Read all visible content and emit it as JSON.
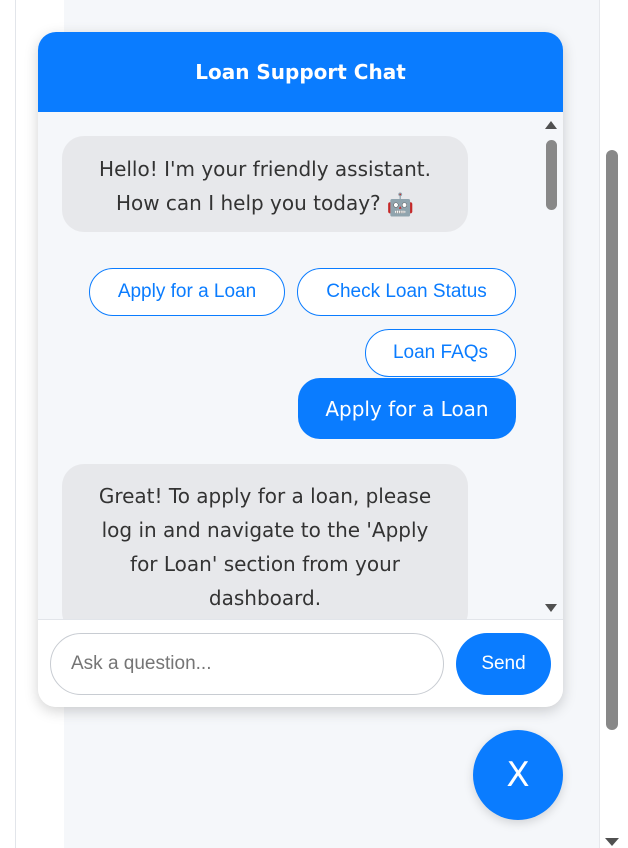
{
  "colors": {
    "accent": "#0a7cff",
    "bot_bubble": "#e7e8eb",
    "panel_bg": "#f5f7fa",
    "text": "#333333"
  },
  "chat": {
    "title": "Loan Support Chat",
    "messages": [
      {
        "from": "bot",
        "lines": [
          "Hello! I'm your friendly assistant.",
          "How can I help you today?"
        ],
        "emoji": "🤖"
      },
      {
        "from": "user",
        "text": "Apply for a Loan"
      },
      {
        "from": "bot",
        "lines": [
          "Great! To apply for a loan, please",
          "log in and navigate to the 'Apply",
          "for Loan' section from your",
          "dashboard."
        ]
      }
    ],
    "quick_replies": [
      "Apply for a Loan",
      "Check Loan Status",
      "Loan FAQs"
    ],
    "input": {
      "placeholder": "Ask a question...",
      "value": ""
    },
    "send_label": "Send"
  },
  "close_button": {
    "label": "X"
  },
  "icons": {
    "bot_emoji": "robot-icon",
    "scroll_up": "chevron-up-icon",
    "scroll_down": "chevron-down-icon"
  }
}
